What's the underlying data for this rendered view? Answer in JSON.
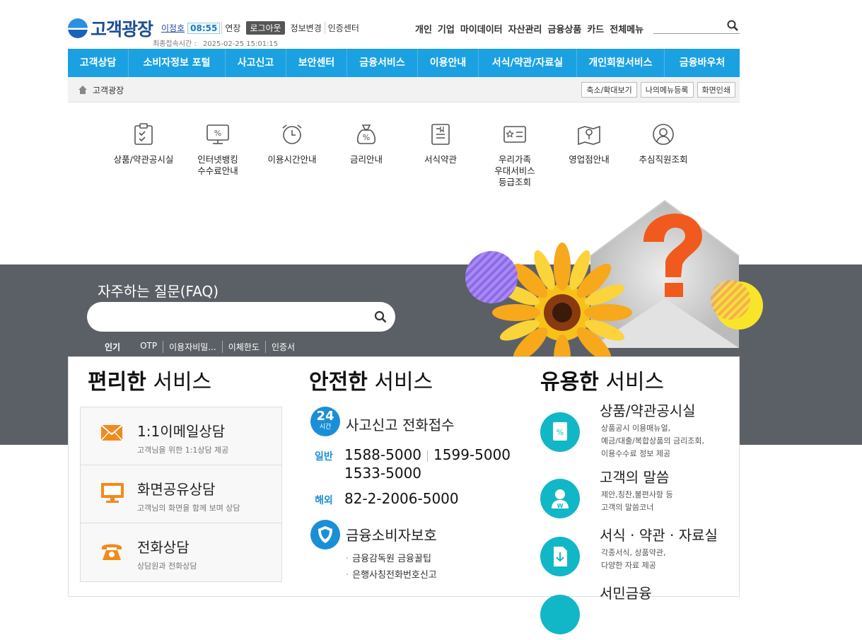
{
  "header": {
    "logo": "고객광장",
    "user_name": "이정호",
    "timer": "08:55",
    "extend": "연장",
    "logout": "로그아웃",
    "links": [
      "정보변경",
      "인증센터"
    ],
    "last_login_label": "최종접속시간 :",
    "last_login_value": "2025-02-25 15:01:15",
    "top_nav": [
      "개인",
      "기업",
      "마이데이터",
      "자산관리",
      "금융상품",
      "카드",
      "전체메뉴"
    ],
    "search_placeholder": ""
  },
  "gnb": [
    "고객상담",
    "소비자정보 포털",
    "사고신고",
    "보안센터",
    "금융서비스",
    "이용안내",
    "서식/약관/자료실",
    "개인회원서비스",
    "금융바우처"
  ],
  "breadcrumb": {
    "home": "고객광장",
    "tools": [
      "축소/확대보기",
      "나의메뉴등록",
      "화면인쇄"
    ]
  },
  "quick_menu": [
    {
      "label": "상품/약관공시실",
      "icon": "clipboard-check-icon"
    },
    {
      "label": "인터넷뱅킹\n수수료안내",
      "icon": "monitor-percent-icon"
    },
    {
      "label": "이용시간안내",
      "icon": "alarm-clock-icon"
    },
    {
      "label": "금리안내",
      "icon": "money-bag-percent-icon"
    },
    {
      "label": "서식약관",
      "icon": "document-icon"
    },
    {
      "label": "우리가족\n우대서비스\n등급조회",
      "icon": "star-card-icon"
    },
    {
      "label": "영업점안내",
      "icon": "map-pin-icon"
    },
    {
      "label": "추심직원조회",
      "icon": "person-search-icon"
    }
  ],
  "faq": {
    "title": "자주하는 질문(FAQ)",
    "placeholder": "",
    "popular_label": "인기",
    "keywords": [
      "OTP",
      "이용자비밀...",
      "이체한도",
      "인증서"
    ]
  },
  "services": {
    "convenient": {
      "title_bold": "편리한",
      "title_rest": " 서비스",
      "items": [
        {
          "title": "1:1이메일상담",
          "desc": "고객님을 위한 1:1상담 제공",
          "icon": "envelope-icon"
        },
        {
          "title": "화면공유상담",
          "desc": "고객님의 화면을 함께 보며 상담",
          "icon": "monitor-icon"
        },
        {
          "title": "전화상담",
          "desc": "상담원과 전화상담",
          "icon": "telephone-icon"
        }
      ]
    },
    "safe": {
      "title_bold": "안전한",
      "title_rest": " 서비스",
      "badge_num": "24",
      "badge_unit": "시간",
      "accident_title": "사고신고 전화접수",
      "general_label": "일반",
      "numbers": [
        "1588-5000",
        "1599-5000",
        "1533-5000"
      ],
      "overseas_label": "해외",
      "overseas_number": "82-2-2006-5000",
      "protect_title": "금융소비자보호",
      "protect_items": [
        "금융감독원 금융꿀팁",
        "은행사칭전화번호신고"
      ]
    },
    "useful": {
      "title_bold": "유용한",
      "title_rest": " 서비스",
      "items": [
        {
          "title": "상품/약관공시실",
          "desc": "상품공시 이용매뉴얼,\n예금/대출/복합상품의 금리조회,\n이용수수료 정보 제공",
          "icon": "document-percent-icon"
        },
        {
          "title": "고객의 말씀",
          "desc": "제안,칭찬,불편사항 등\n고객의 말씀코너",
          "icon": "customer-voice-icon"
        },
        {
          "title": "서식 · 약관 · 자료실",
          "desc": "각종서식, 상품약관,\n다양한 자료 제공",
          "icon": "download-document-icon"
        },
        {
          "title": "서민금융",
          "desc": "",
          "icon": "finance-icon"
        }
      ]
    }
  },
  "colors": {
    "primary": "#1ba1e2",
    "band": "#5b6066",
    "teal": "#12b7c7",
    "orange": "#f28a1c"
  }
}
